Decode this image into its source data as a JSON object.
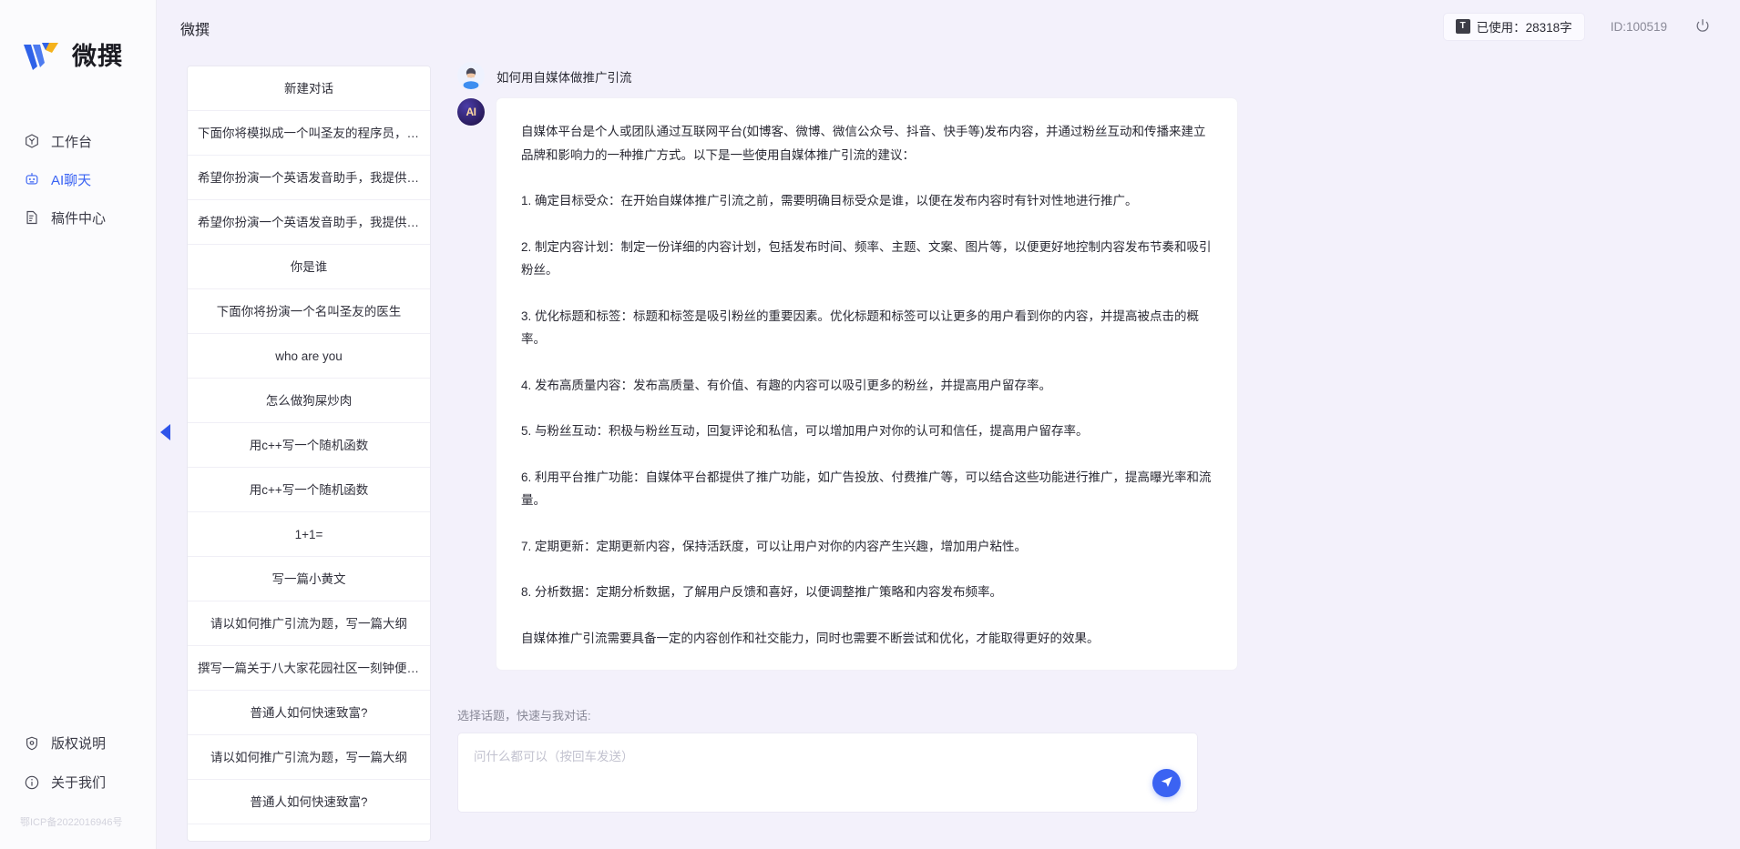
{
  "brand": {
    "name": "微撰",
    "logo_icon": "w-logo-icon"
  },
  "nav": {
    "items": [
      {
        "label": "工作台",
        "icon": "workbench-icon",
        "active": false
      },
      {
        "label": "AI聊天",
        "icon": "robot-icon",
        "active": true
      },
      {
        "label": "稿件中心",
        "icon": "document-edit-icon",
        "active": false
      }
    ],
    "bottom_items": [
      {
        "label": "版权说明",
        "icon": "shield-icon"
      },
      {
        "label": "关于我们",
        "icon": "info-icon"
      }
    ],
    "icp": "鄂ICP备2022016946号"
  },
  "header": {
    "title": "微撰",
    "usage_label": "已使用：28318字",
    "usage_badge": "T",
    "account_id": "ID:100519",
    "power_icon": "power-icon"
  },
  "conversations": {
    "new_chat_label": "新建对话",
    "items": [
      "下面你将模拟成一个叫圣友的程序员，我说...",
      "希望你扮演一个英语发音助手，我提供给你...",
      "希望你扮演一个英语发音助手，我提供给你...",
      "你是谁",
      "下面你将扮演一个名叫圣友的医生",
      "who are you",
      "怎么做狗屎炒肉",
      "用c++写一个随机函数",
      "用c++写一个随机函数",
      "1+1=",
      "写一篇小黄文",
      "请以如何推广引流为题，写一篇大纲",
      "撰写一篇关于八大家花园社区一刻钟便民生...",
      "普通人如何快速致富?",
      "请以如何推广引流为题，写一篇大纲",
      "普通人如何快速致富?"
    ],
    "collapse_icon": "chevron-left-icon"
  },
  "chat": {
    "user_avatar_icon": "user-avatar-icon",
    "ai_avatar_label": "AI",
    "user_message": "如何用自媒体做推广引流",
    "ai_paragraphs": [
      "自媒体平台是个人或团队通过互联网平台(如博客、微博、微信公众号、抖音、快手等)发布内容，并通过粉丝互动和传播来建立品牌和影响力的一种推广方式。以下是一些使用自媒体推广引流的建议：",
      "1. 确定目标受众：在开始自媒体推广引流之前，需要明确目标受众是谁，以便在发布内容时有针对性地进行推广。",
      "2. 制定内容计划：制定一份详细的内容计划，包括发布时间、频率、主题、文案、图片等，以便更好地控制内容发布节奏和吸引粉丝。",
      "3. 优化标题和标签：标题和标签是吸引粉丝的重要因素。优化标题和标签可以让更多的用户看到你的内容，并提高被点击的概率。",
      "4. 发布高质量内容：发布高质量、有价值、有趣的内容可以吸引更多的粉丝，并提高用户留存率。",
      "5. 与粉丝互动：积极与粉丝互动，回复评论和私信，可以增加用户对你的认可和信任，提高用户留存率。",
      "6. 利用平台推广功能：自媒体平台都提供了推广功能，如广告投放、付费推广等，可以结合这些功能进行推广，提高曝光率和流量。",
      "7. 定期更新：定期更新内容，保持活跃度，可以让用户对你的内容产生兴趣，增加用户粘性。",
      "8. 分析数据：定期分析数据，了解用户反馈和喜好，以便调整推广策略和内容发布频率。",
      "自媒体推广引流需要具备一定的内容创作和社交能力，同时也需要不断尝试和优化，才能取得更好的效果。"
    ]
  },
  "composer": {
    "label": "选择话题，快速与我对话:",
    "placeholder": "问什么都可以（按回车发送）",
    "value": "",
    "send_icon": "send-paper-plane-icon"
  },
  "colors": {
    "accent": "#3b63f2",
    "page_bg": "#f3f1fb",
    "panel_bg": "#ffffff"
  }
}
